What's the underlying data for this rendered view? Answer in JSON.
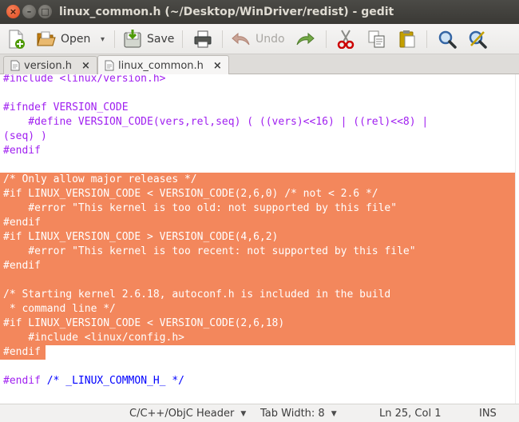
{
  "window": {
    "title": "linux_common.h (~/Desktop/WinDriver/redist) - gedit",
    "close_glyph": "×",
    "minimize_glyph": "–",
    "maximize_glyph": "□"
  },
  "toolbar": {
    "open_label": "Open",
    "save_label": "Save",
    "undo_label": "Undo",
    "dropdown_glyph": "▾"
  },
  "tabs": [
    {
      "label": "version.h",
      "close": "×"
    },
    {
      "label": "linux_common.h",
      "close": "×"
    }
  ],
  "editor": {
    "highlight_color": "#f3875c",
    "lines": [
      {
        "text": "#include <linux/version.h>",
        "cls": "pp"
      },
      {
        "text": "",
        "cls": ""
      },
      {
        "text": "#ifndef VERSION_CODE",
        "cls": "pp"
      },
      {
        "text": "    #define VERSION_CODE(vers,rel,seq) ( ((vers)<<16) | ((rel)<<8) |",
        "cls": "pp"
      },
      {
        "text": "(seq) )",
        "cls": "pp"
      },
      {
        "text": "#endif",
        "cls": "pp"
      },
      {
        "text": "",
        "cls": ""
      },
      {
        "text": "/* Only allow major releases */",
        "cls": "cm"
      },
      {
        "text": "#if LINUX_VERSION_CODE < VERSION_CODE(2,6,0) /* not < 2.6 */",
        "cls": "pp"
      },
      {
        "text": "    #error \"This kernel is too old: not supported by this file\"",
        "cls": "pp"
      },
      {
        "text": "#endif",
        "cls": "pp"
      },
      {
        "text": "#if LINUX_VERSION_CODE > VERSION_CODE(4,6,2)",
        "cls": "pp"
      },
      {
        "text": "    #error \"This kernel is too recent: not supported by this file\"",
        "cls": "pp"
      },
      {
        "text": "#endif",
        "cls": "pp"
      },
      {
        "text": "",
        "cls": ""
      },
      {
        "text": "/* Starting kernel 2.6.18, autoconf.h is included in the build",
        "cls": "cm"
      },
      {
        "text": " * command line */",
        "cls": "cm"
      },
      {
        "text": "#if LINUX_VERSION_CODE < VERSION_CODE(2,6,18)",
        "cls": "pp"
      },
      {
        "text": "    #include <linux/config.h>",
        "cls": "pp"
      },
      {
        "text": "#endif",
        "cls": "pp"
      },
      {
        "text": "",
        "cls": ""
      },
      {
        "text": "#endif /* _LINUX_COMMON_H_ */",
        "cls": "mix"
      }
    ]
  },
  "statusbar": {
    "language": "C/C++/ObjC Header",
    "tab_width": "Tab Width: 8",
    "position": "Ln 25, Col 1",
    "mode": "INS",
    "dropdown_glyph": "▼"
  }
}
